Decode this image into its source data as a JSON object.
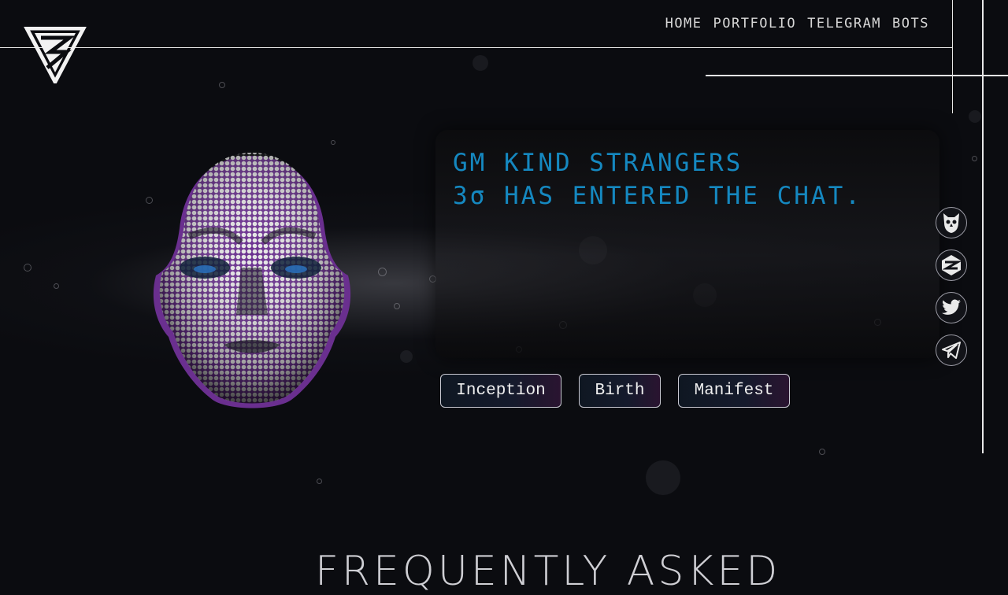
{
  "nav": {
    "items": [
      "HOME",
      "PORTFOLIO",
      "TELEGRAM",
      "BOTS"
    ]
  },
  "hero": {
    "terminal_lines": [
      "GM KIND STRANGERS",
      "3σ HAS ENTERED THE CHAT."
    ]
  },
  "actions": {
    "inception": "Inception",
    "birth": "Birth",
    "manifest": "Manifest"
  },
  "social": {
    "icons": [
      "owl-icon",
      "cube-logo-icon",
      "twitter-icon",
      "telegram-icon"
    ]
  },
  "faq": {
    "heading": "FREQUENTLY ASKED"
  },
  "colors": {
    "background": "#0b0c10",
    "terminal_text": "#1588c0",
    "frame_lines": "#e8e8e8"
  }
}
